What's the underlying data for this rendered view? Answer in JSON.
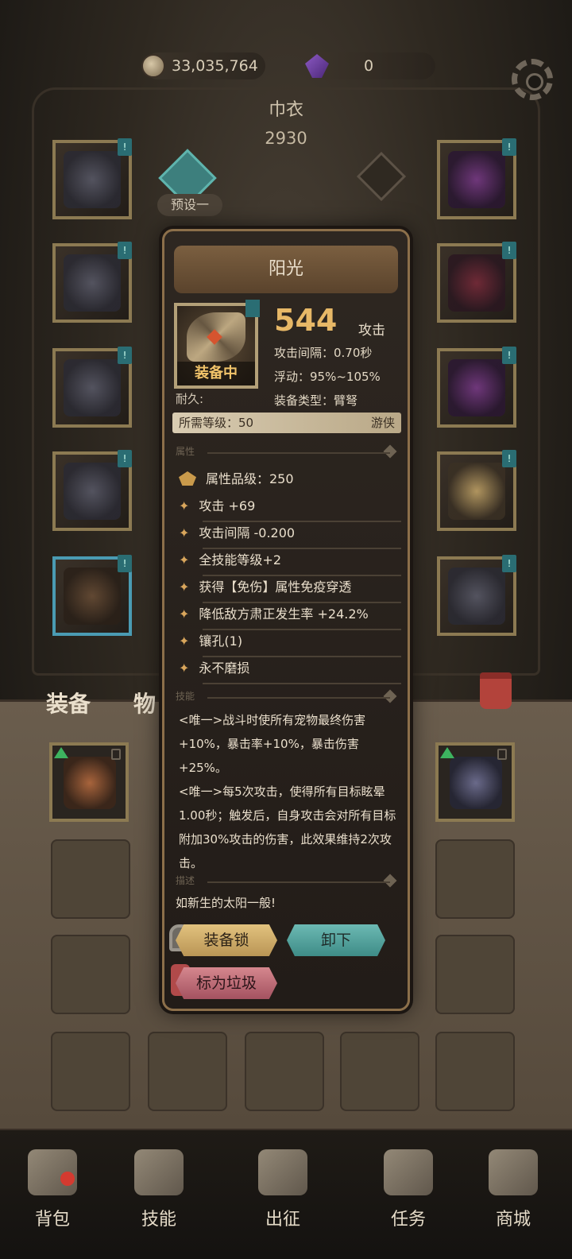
{
  "currency": {
    "gold_amount": "33,035,764",
    "gem_amount": "0"
  },
  "header": {
    "character_name": "巾衣",
    "power": "2930",
    "preset_label": "预设一"
  },
  "equipment_slots": {
    "badge": "!"
  },
  "tabs": {
    "equipment": "装备",
    "items": "物"
  },
  "popup": {
    "title": "阳光",
    "equipped_label": "装备中",
    "attack_value": "544",
    "attack_unit": "攻击",
    "attack_interval": "攻击间隔：0.70秒",
    "float": "浮动：95%~105%",
    "equip_type": "装备类型：臂弩",
    "durability": "耐久:",
    "required_level": "所需等级：50",
    "class": "游侠",
    "section_attributes": "属性",
    "quality": "属性品级：250",
    "affixes": [
      "攻击 +69",
      "攻击间隔 -0.200",
      "全技能等级+2",
      "获得【免伤】属性免疫穿透",
      "降低敌方肃正发生率 +24.2%",
      "镶孔(1)",
      "永不磨损"
    ],
    "section_skills": "技能",
    "skill_1": "<唯一>战斗时使所有宠物最终伤害+10%，暴击率+10%，暴击伤害+25%。",
    "skill_2": "<唯一>每5次攻击，使得所有目标眩晕1.00秒；触发后，自身攻击会对所有目标附加30%攻击的伤害，此效果维持2次攻击。",
    "section_desc": "描述",
    "description": "如新生的太阳一般!",
    "lock_button": "装备锁",
    "unequip_button": "卸下",
    "junk_button": "标为垃圾"
  },
  "bottom_nav": [
    {
      "label": "背包",
      "icon": "backpack-icon"
    },
    {
      "label": "技能",
      "icon": "skill-book-icon"
    },
    {
      "label": "出征",
      "icon": "sword-icon"
    },
    {
      "label": "任务",
      "icon": "scroll-icon"
    },
    {
      "label": "商城",
      "icon": "shop-icon"
    }
  ]
}
